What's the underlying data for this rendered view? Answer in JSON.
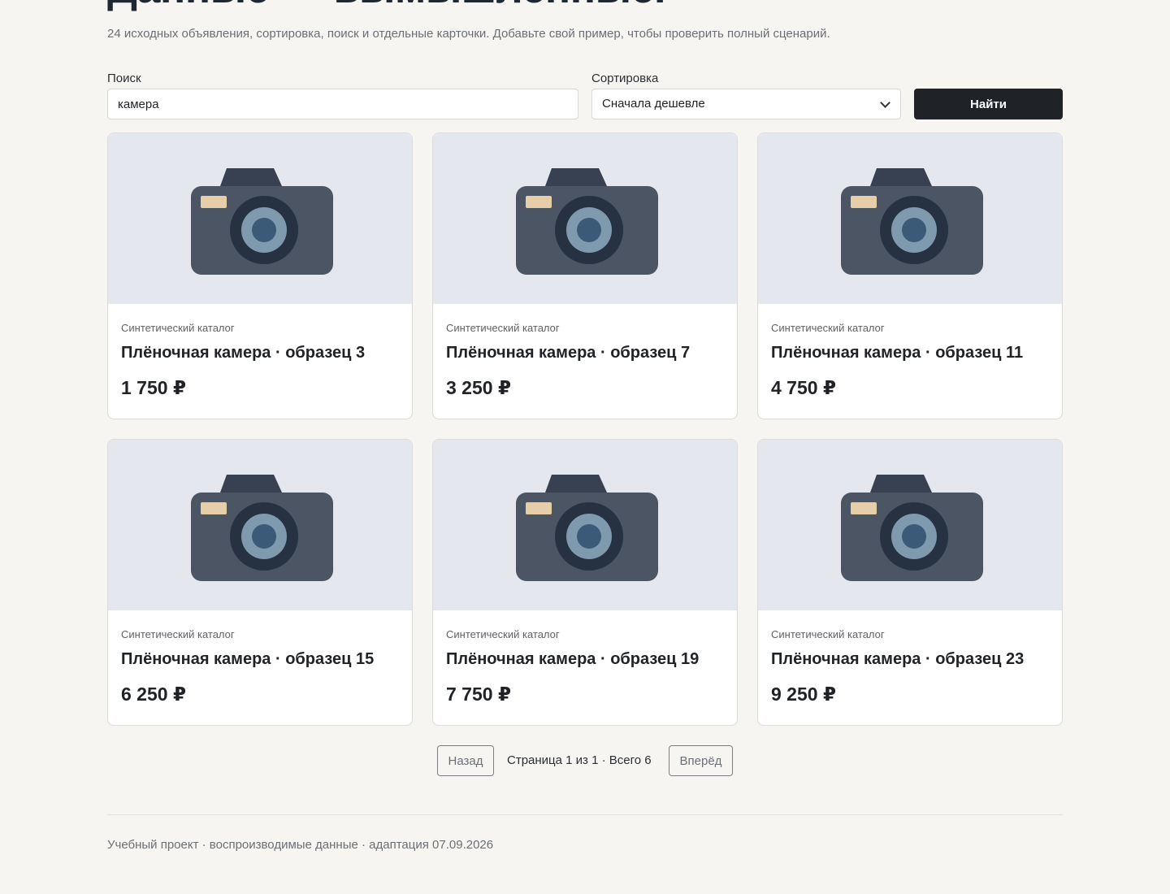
{
  "header": {
    "title": "Данные — вымышленные.",
    "subtitle": "24 исходных объявления, сортировка, поиск и отдельные карточки. Добавьте свой пример, чтобы проверить полный сценарий."
  },
  "controls": {
    "search_label": "Поиск",
    "search_value": "камера",
    "sort_label": "Сортировка",
    "sort_value": "Сначала дешевле",
    "find_button": "Найти"
  },
  "cards": [
    {
      "source": "Синтетический каталог",
      "title": "Плёночная камера · образец 3",
      "price": "1 750 ₽",
      "icon": "camera-icon"
    },
    {
      "source": "Синтетический каталог",
      "title": "Плёночная камера · образец 7",
      "price": "3 250 ₽",
      "icon": "camera-icon"
    },
    {
      "source": "Синтетический каталог",
      "title": "Плёночная камера · образец 11",
      "price": "4 750 ₽",
      "icon": "camera-icon"
    },
    {
      "source": "Синтетический каталог",
      "title": "Плёночная камера · образец 15",
      "price": "6 250 ₽",
      "icon": "camera-icon"
    },
    {
      "source": "Синтетический каталог",
      "title": "Плёночная камера · образец 19",
      "price": "7 750 ₽",
      "icon": "camera-icon"
    },
    {
      "source": "Синтетический каталог",
      "title": "Плёночная камера · образец 23",
      "price": "9 250 ₽",
      "icon": "camera-icon"
    }
  ],
  "pagination": {
    "prev_label": "Назад",
    "info": "Страница 1 из 1 · Всего 6",
    "next_label": "Вперёд"
  },
  "footer": {
    "text": "Учебный проект · воспроизводимые данные · адаптация 07.09.2026"
  },
  "colors": {
    "page_bg": "#f6f5f2",
    "accent": "#1f2328",
    "image_bg": "#e4e7ee",
    "camera_body": "#4b5563"
  }
}
